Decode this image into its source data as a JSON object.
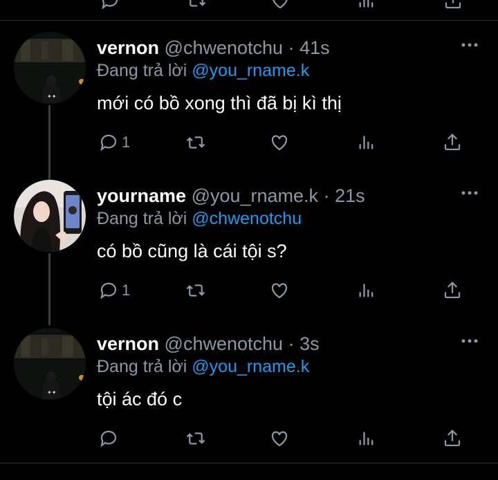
{
  "colors": {
    "background": "#000000",
    "text": "#e7e9ea",
    "muted": "#8b98a5",
    "mention": "#1d9bf0",
    "divider": "#2f3336"
  },
  "icons": {
    "reply": "reply-icon",
    "retweet": "retweet-icon",
    "like": "heart-icon",
    "views": "views-icon",
    "share": "share-icon",
    "more": "more-icon"
  },
  "tweets": [
    {
      "name": "vernon",
      "handle": "@chwenotchu",
      "dot": "·",
      "time": "41s",
      "reply_label": "Đang trả lời",
      "reply_to": "@you_rname.k",
      "text": "mới có bồ xong thì đã bị kì thị",
      "reply_count": "1"
    },
    {
      "name": "yourname",
      "handle": "@you_rname.k",
      "dot": "·",
      "time": "21s",
      "reply_label": "Đang trả lời",
      "reply_to": "@chwenotchu",
      "text": "có bồ cũng là cái tội s?",
      "reply_count": "1"
    },
    {
      "name": "vernon",
      "handle": "@chwenotchu",
      "dot": "·",
      "time": "3s",
      "reply_label": "Đang trả lời",
      "reply_to": "@you_rname.k",
      "text": "tội ác đó c",
      "reply_count": ""
    }
  ]
}
